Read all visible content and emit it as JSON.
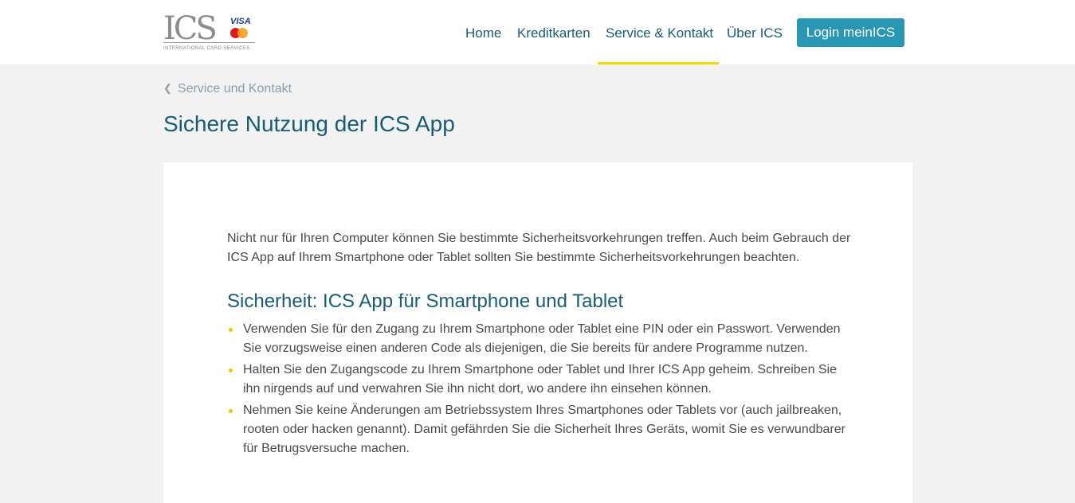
{
  "header": {
    "logo": {
      "main_text": "ICS",
      "visa_text": "VISA",
      "mastercard_text": "MasterCard",
      "subtitle": "INTERNATIONAL CARD SERVICES"
    },
    "nav": [
      {
        "label": "Home"
      },
      {
        "label": "Kreditkarten"
      },
      {
        "label": "Service & Kontakt",
        "active": true
      },
      {
        "label": "Über ICS"
      }
    ],
    "login_label": "Login meinICS"
  },
  "breadcrumb": {
    "chevron_icon": "chevron-left-icon",
    "label": "Service und Kontakt"
  },
  "page_title": "Sichere Nutzung der ICS App",
  "content": {
    "intro": "Nicht nur für Ihren Computer können Sie bestimmte Sicherheitsvorkehrungen treffen. Auch beim Gebrauch der ICS App auf Ihrem Smartphone oder Tablet sollten Sie bestimmte Sicherheitsvorkehrungen beachten.",
    "section_heading": "Sicherheit: ICS App für Smartphone und Tablet",
    "bullets": [
      "Verwenden Sie für den Zugang zu Ihrem Smartphone oder Tablet eine PIN oder ein Passwort. Verwenden Sie vorzugsweise einen anderen Code als diejenigen, die Sie bereits für andere Programme nutzen.",
      "Halten Sie den Zugangscode zu Ihrem Smartphone oder Tablet und Ihrer ICS App geheim. Schreiben Sie ihn nirgends auf und verwahren Sie ihn nicht dort, wo andere ihn einsehen können.",
      "Nehmen Sie keine Änderungen am Betriebssystem Ihres Smartphones oder Tablets vor (auch jailbreaken, rooten oder hacken genannt). Damit gefährden Sie die Sicherheit Ihres Geräts, womit Sie es verwundbarer für Betrugsversuche machen."
    ]
  },
  "colors": {
    "accent_blue": "#175d76",
    "button_blue": "#2996b3",
    "nav_underline_yellow": "#f2db00",
    "bullet_yellow": "#f2c500",
    "page_background": "#f2f2f2"
  }
}
